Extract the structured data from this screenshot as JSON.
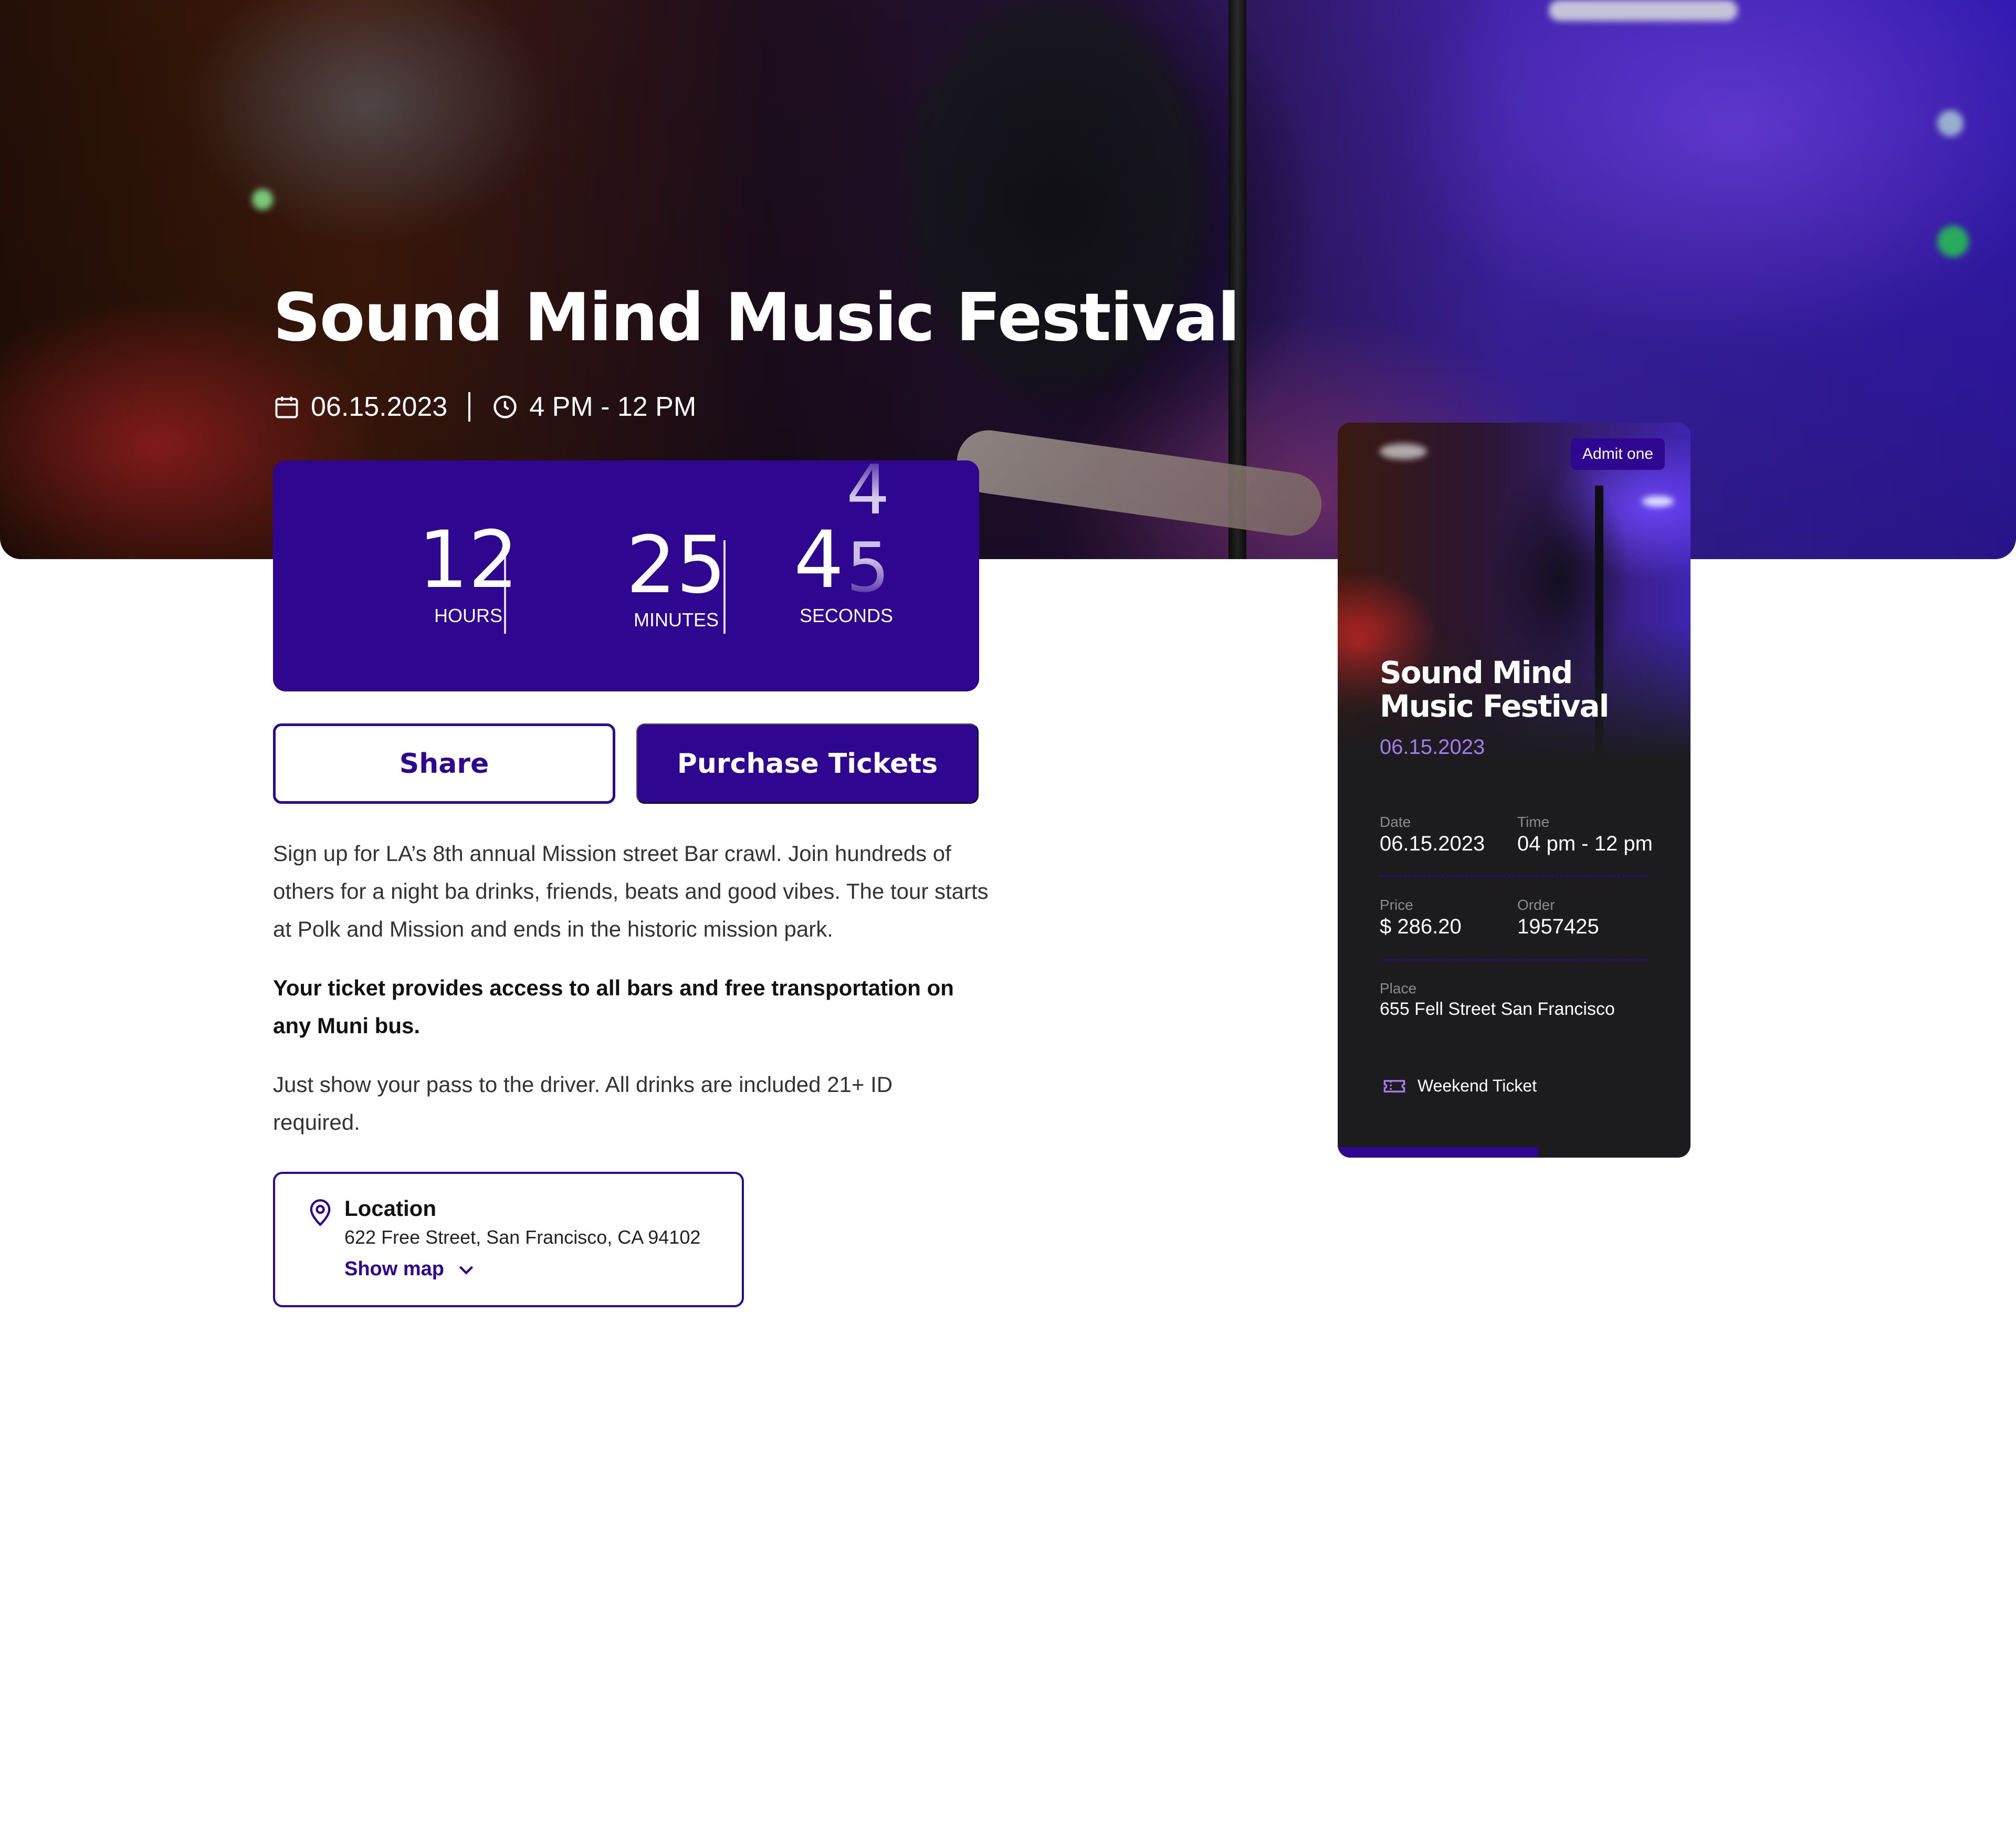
{
  "event": {
    "title": "Sound Mind Music Festival",
    "date": "06.15.2023",
    "time": "4 PM - 12 PM"
  },
  "countdown": {
    "hours": "12",
    "hours_label": "HOURS",
    "minutes": "25",
    "minutes_label": "MINUTES",
    "seconds_tens": "4",
    "seconds_ones": "5",
    "seconds_next": "4",
    "seconds_label": "SECONDS"
  },
  "actions": {
    "share_label": "Share",
    "purchase_label": "Purchase Tickets"
  },
  "description": {
    "paragraph1": "Sign up for LA’s 8th annual Mission street Bar crawl. Join hundreds of others for a night ba drinks, friends, beats and good vibes. The tour starts at Polk and Mission and ends in the historic mission park.",
    "paragraph2": "Your ticket provides access to all bars and free transportation on any Muni bus.",
    "paragraph3": "Just show your pass to the driver. All drinks are included 21+ ID required."
  },
  "location": {
    "title": "Location",
    "address": "622 Free Street, San Francisco, CA 94102",
    "show_map_label": "Show map"
  },
  "ticket": {
    "badge": "Admit one",
    "title": "Sound Mind Music Festival",
    "date": "06.15.2023",
    "fields": {
      "date_label": "Date",
      "date_value": "06.15.2023",
      "time_label": "Time",
      "time_value": "04 pm - 12 pm",
      "price_label": "Price",
      "price_value": "$ 286.20",
      "order_label": "Order",
      "order_value": "1957425",
      "place_label": "Place",
      "place_value": "655 Fell Street San Francisco"
    },
    "type": "Weekend Ticket"
  },
  "icons": {
    "date": "calendar-icon",
    "time": "clock-icon",
    "location": "map-pin-icon",
    "show_map": "chevron-down-icon",
    "ticket_type": "ticket-icon"
  },
  "colors": {
    "accent": "#2e0690",
    "ticket_background": "#1c1c1f",
    "ticket_date": "#a57cf0"
  }
}
